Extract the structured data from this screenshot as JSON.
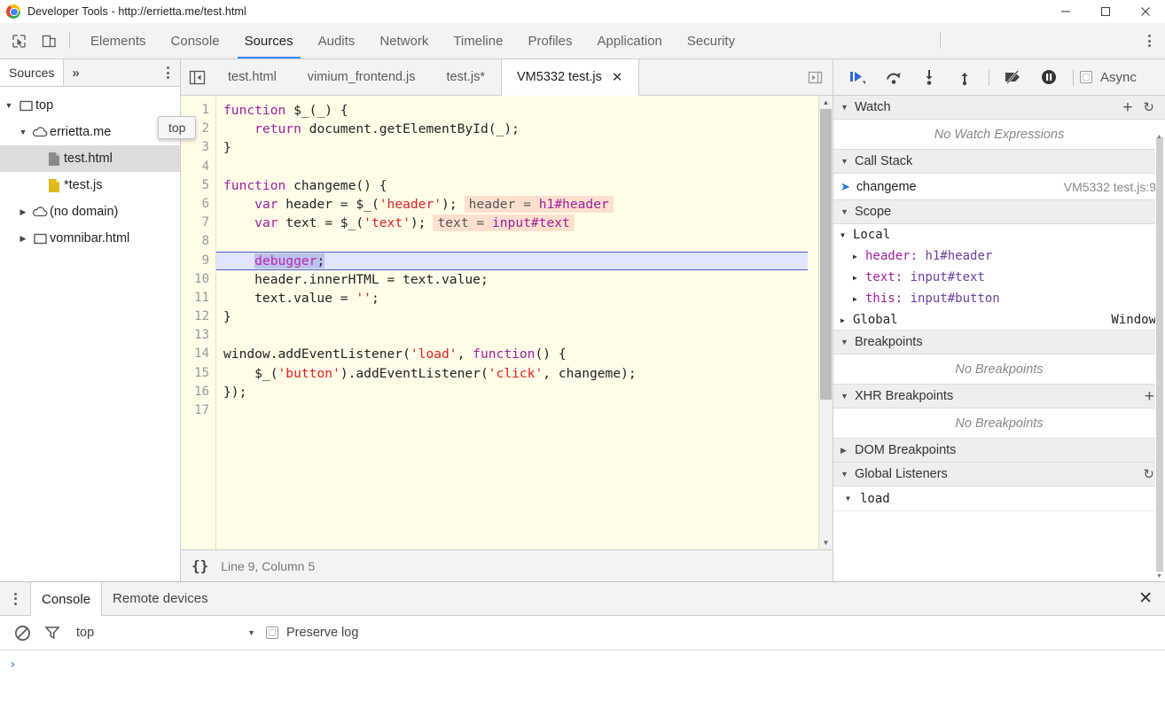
{
  "window": {
    "title": "Developer Tools - http://errietta.me/test.html",
    "controls": {
      "minimize": "minimize-icon",
      "maximize": "maximize-icon",
      "close": "close-icon"
    }
  },
  "main_toolbar": {
    "inspect_icon": "inspect-element-icon",
    "device_icon": "device-toolbar-icon",
    "menu_icon": "kebab-menu-icon",
    "tabs": [
      {
        "label": "Elements",
        "active": false
      },
      {
        "label": "Console",
        "active": false
      },
      {
        "label": "Sources",
        "active": true
      },
      {
        "label": "Audits",
        "active": false
      },
      {
        "label": "Network",
        "active": false
      },
      {
        "label": "Timeline",
        "active": false
      },
      {
        "label": "Profiles",
        "active": false
      },
      {
        "label": "Application",
        "active": false
      },
      {
        "label": "Security",
        "active": false
      }
    ]
  },
  "navigator": {
    "tab_label": "Sources",
    "more_label": "»",
    "menu_icon": "kebab-menu-icon",
    "tooltip": "top",
    "tree": [
      {
        "label": "top",
        "level": 1,
        "icon": "frame-icon",
        "twist": "▼",
        "selected": false
      },
      {
        "label": "errietta.me",
        "level": 2,
        "icon": "cloud-icon",
        "twist": "▼",
        "selected": false
      },
      {
        "label": "test.html",
        "level": 3,
        "icon": "document-icon",
        "twist": "",
        "selected": true
      },
      {
        "label": "*test.js",
        "level": 3,
        "icon": "script-icon",
        "twist": "",
        "selected": false
      },
      {
        "label": "(no domain)",
        "level": 2,
        "icon": "cloud-icon",
        "twist": "▶",
        "selected": false
      },
      {
        "label": "vomnibar.html",
        "level": 2,
        "icon": "frame-icon",
        "twist": "▶",
        "selected": false
      }
    ]
  },
  "editor": {
    "panel_toggle_icon": "show-navigator-icon",
    "more_tabs_icon": "more-tabs-icon",
    "file_tabs": [
      {
        "label": "test.html",
        "active": false,
        "closable": false
      },
      {
        "label": "vimium_frontend.js",
        "active": false,
        "closable": false
      },
      {
        "label": "test.js*",
        "active": false,
        "closable": false
      },
      {
        "label": "VM5332 test.js",
        "active": true,
        "closable": true,
        "close_label": "✕"
      }
    ],
    "status": {
      "format_icon": "{}",
      "position": "Line 9, Column 5"
    },
    "lines": [
      {
        "n": "1",
        "html": "<span class=\"kw\">function</span> $_(_) {"
      },
      {
        "n": "2",
        "html": "    <span class=\"kw\">return</span> document.getElementById(_);"
      },
      {
        "n": "3",
        "html": "}"
      },
      {
        "n": "4",
        "html": ""
      },
      {
        "n": "5",
        "html": "<span class=\"kw\">function</span> changeme() {"
      },
      {
        "n": "6",
        "html": "    <span class=\"kw\">var</span> header = $_(<span class=\"str\">'header'</span>);<span class=\"hint\">header = <span class=\"hv\">h1#header</span></span>"
      },
      {
        "n": "7",
        "html": "    <span class=\"kw\">var</span> text = $_(<span class=\"str\">'text'</span>);<span class=\"hint\">text = <span class=\"hv\">input#text</span></span>"
      },
      {
        "n": "8",
        "html": ""
      },
      {
        "n": "9",
        "html": "    <span class=\"sel-tok\"><span class=\"kw2\">debugger</span>;</span>",
        "executing": true
      },
      {
        "n": "10",
        "html": "    header.innerHTML = text.value;"
      },
      {
        "n": "11",
        "html": "    text.value = <span class=\"str\">''</span>;"
      },
      {
        "n": "12",
        "html": "}"
      },
      {
        "n": "13",
        "html": ""
      },
      {
        "n": "14",
        "html": "window.addEventListener(<span class=\"str\">'load'</span>, <span class=\"kw\">function</span>() {"
      },
      {
        "n": "15",
        "html": "    $_(<span class=\"str\">'button'</span>).addEventListener(<span class=\"str\">'click'</span>, changeme);"
      },
      {
        "n": "16",
        "html": "});"
      },
      {
        "n": "17",
        "html": ""
      }
    ]
  },
  "debugger": {
    "toolbar": {
      "resume_icon": "resume-script-icon",
      "step_over_icon": "step-over-icon",
      "step_into_icon": "step-into-icon",
      "step_out_icon": "step-out-icon",
      "deactivate_breakpoints_icon": "deactivate-breakpoints-icon",
      "pause_on_exceptions_icon": "pause-on-exceptions-icon",
      "async_label": "Async",
      "async_checked": false
    },
    "watch": {
      "title": "Watch",
      "add_icon": "+",
      "refresh_icon": "↻",
      "empty": "No Watch Expressions"
    },
    "call_stack": {
      "title": "Call Stack",
      "frames": [
        {
          "name": "changeme",
          "location": "VM5332 test.js:9",
          "active": true
        }
      ]
    },
    "scope": {
      "title": "Scope",
      "groups": [
        {
          "name": "Local",
          "twist": "▼",
          "value": ""
        },
        {
          "name": "Global",
          "twist": "▶",
          "value": "Window"
        }
      ],
      "locals": [
        {
          "name": "header",
          "value": "h1#header",
          "twist": "▶"
        },
        {
          "name": "text",
          "value": "input#text",
          "twist": "▶"
        },
        {
          "name": "this",
          "value": "input#button",
          "twist": "▶"
        }
      ]
    },
    "breakpoints": {
      "title": "Breakpoints",
      "empty": "No Breakpoints"
    },
    "xhr_breakpoints": {
      "title": "XHR Breakpoints",
      "empty": "No Breakpoints",
      "add_icon": "+"
    },
    "dom_breakpoints": {
      "title": "DOM Breakpoints",
      "twist": "▶"
    },
    "global_listeners": {
      "title": "Global Listeners",
      "refresh_icon": "↻",
      "items": [
        {
          "label": "load",
          "twist": "▼"
        }
      ]
    }
  },
  "drawer": {
    "menu_icon": "kebab-menu-icon",
    "close_icon": "✕",
    "tabs": [
      {
        "label": "Console",
        "active": true
      },
      {
        "label": "Remote devices",
        "active": false
      }
    ],
    "console_toolbar": {
      "clear_icon": "clear-console-icon",
      "filter_icon": "filter-icon",
      "context": "top",
      "context_caret": "▼",
      "preserve_log_label": "Preserve log",
      "preserve_log_checked": false
    },
    "prompt": "›"
  },
  "colors": {
    "accent": "#4285f4",
    "editor_bg": "#fffde8",
    "exec_line": "#e0e6ff",
    "hint_bg": "#fce0cd",
    "keyword": "#a020a0",
    "string": "#e02020"
  }
}
